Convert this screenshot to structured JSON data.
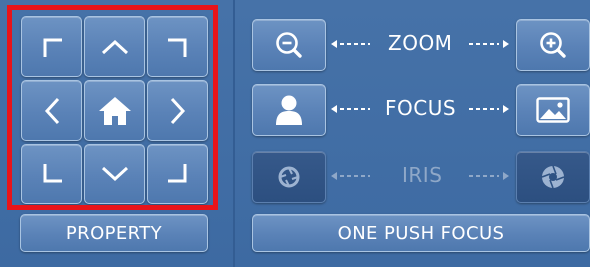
{
  "zoom": {
    "label": "ZOOM",
    "out_icon": "zoom-out-icon",
    "in_icon": "zoom-in-icon"
  },
  "focus": {
    "label": "FOCUS",
    "near_icon": "person-icon",
    "far_icon": "landscape-icon"
  },
  "iris": {
    "label": "IRIS",
    "close_icon": "iris-closed-icon",
    "open_icon": "iris-open-icon"
  },
  "buttons": {
    "property": "PROPERTY",
    "one_push_focus": "ONE PUSH FOCUS"
  },
  "ptz_icons": [
    "corner-up-left-icon",
    "chevron-up-icon",
    "corner-up-right-icon",
    "chevron-left-icon",
    "home-icon",
    "chevron-right-icon",
    "corner-down-left-icon",
    "chevron-down-icon",
    "corner-down-right-icon"
  ],
  "colors": {
    "panel": "#3f6ba3",
    "button": "#5a82b7",
    "highlight": "#e8141a",
    "disabled_text": "#8fa8c8"
  }
}
